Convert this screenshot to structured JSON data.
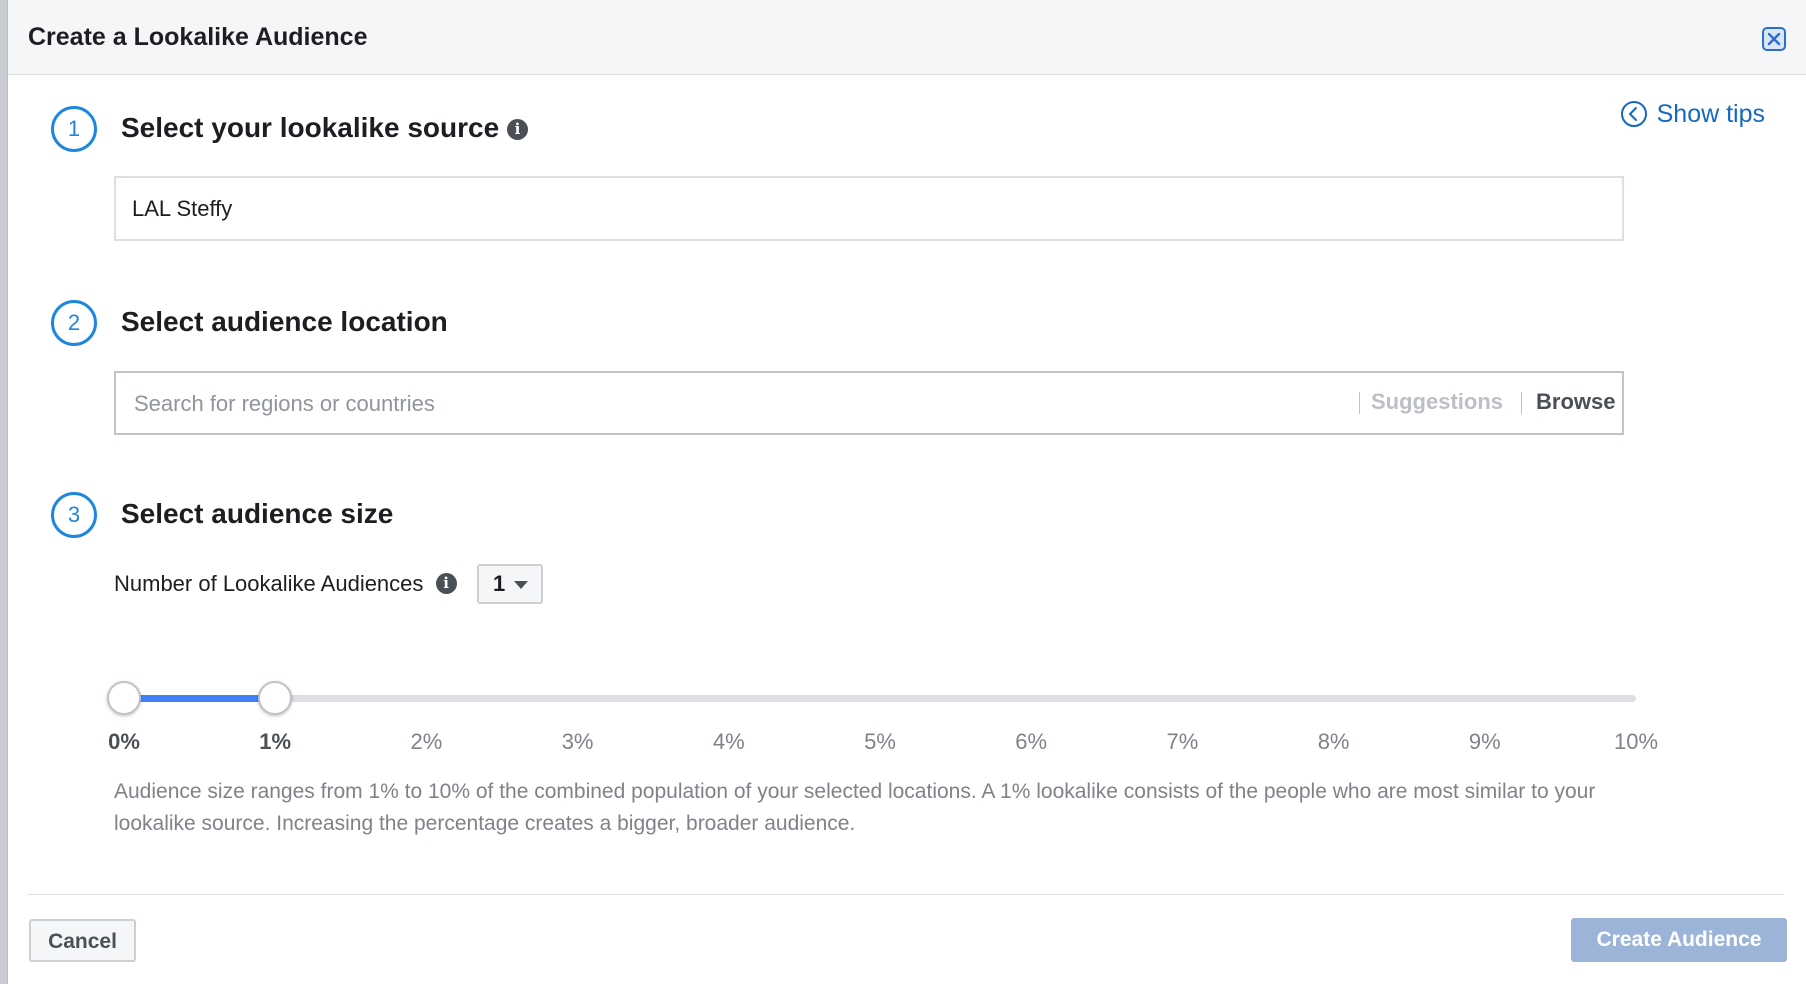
{
  "header": {
    "title": "Create a Lookalike Audience",
    "close_icon": "close-icon"
  },
  "tips": {
    "label": "Show tips",
    "icon": "chevron-left-circle-icon"
  },
  "steps": [
    {
      "number": "1",
      "title": "Select your lookalike source",
      "has_info_icon": true,
      "input_value": "LAL Steffy"
    },
    {
      "number": "2",
      "title": "Select audience location",
      "placeholder": "Search for regions or countries",
      "suggestions_label": "Suggestions",
      "browse_label": "Browse"
    },
    {
      "number": "3",
      "title": "Select audience size",
      "count_label": "Number of Lookalike Audiences",
      "count_value": "1",
      "slider": {
        "min_percent": 0,
        "max_percent": 10,
        "range_start_percent": 0,
        "range_end_percent": 1,
        "ticks": [
          "0%",
          "1%",
          "2%",
          "3%",
          "4%",
          "5%",
          "6%",
          "7%",
          "8%",
          "9%",
          "10%"
        ]
      },
      "description": "Audience size ranges from 1% to 10% of the combined population of your selected locations. A 1% lookalike consists of the people who are most similar to your lookalike source. Increasing the percentage creates a bigger, broader audience."
    }
  ],
  "footer": {
    "cancel_label": "Cancel",
    "create_label": "Create Audience"
  },
  "colors": {
    "accent": "#1d86e0",
    "link": "#1568c4",
    "slider_fill": "#4080ff",
    "create_disabled": "#9cb4d8"
  }
}
